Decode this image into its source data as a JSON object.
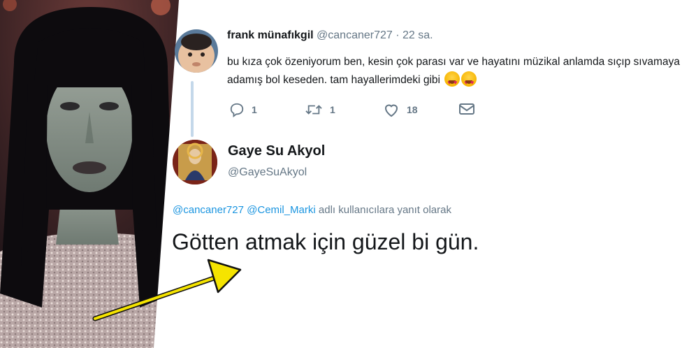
{
  "photo": {
    "description_icon": "woman-portrait-image"
  },
  "tweet1": {
    "display_name": "frank münafıkgil",
    "handle": "@cancaner727",
    "separator": " · ",
    "time": "22 sa.",
    "text": "bu kıza çok özeniyorum ben, kesin çok parası var ve hayatını müzikal anlamda sıçıp sıvamaya adamış bol keseden. tam hayallerimdeki gibi",
    "emojis": [
      "heart-eyes-emoji",
      "heart-eyes-emoji"
    ],
    "actions": {
      "reply_count": "1",
      "retweet_count": "1",
      "like_count": "18"
    }
  },
  "tweet2": {
    "display_name": "Gaye Su Akyol",
    "handle": "@GayeSuAkyol",
    "reply_to": {
      "mention1": "@cancaner727",
      "mention2": "@Cemil_Marki",
      "suffix": "adlı kullanıcılara yanıt olarak"
    },
    "text": "Götten atmak için güzel bi gün."
  },
  "colors": {
    "accent": "#1b95e0",
    "muted": "#657786",
    "text": "#14171a",
    "arrow": "#f5e400",
    "thread_line": "#c4d8ea"
  }
}
